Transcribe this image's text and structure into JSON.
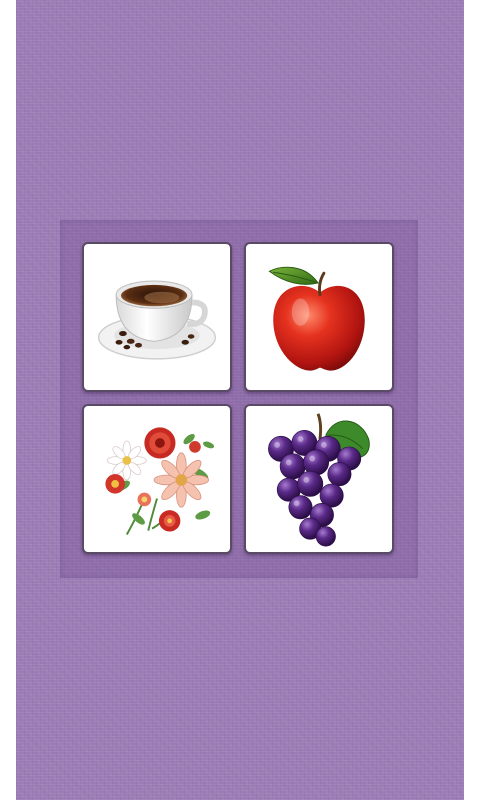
{
  "theme": {
    "background_color": "#9c7cb5",
    "card_border_color": "#5a4a66"
  },
  "board": {
    "rows": 2,
    "columns": 2,
    "cards": [
      {
        "picture": "coffee-cup-icon"
      },
      {
        "picture": "apple-icon"
      },
      {
        "picture": "flower-bouquet-icon"
      },
      {
        "picture": "grapes-icon"
      }
    ]
  }
}
